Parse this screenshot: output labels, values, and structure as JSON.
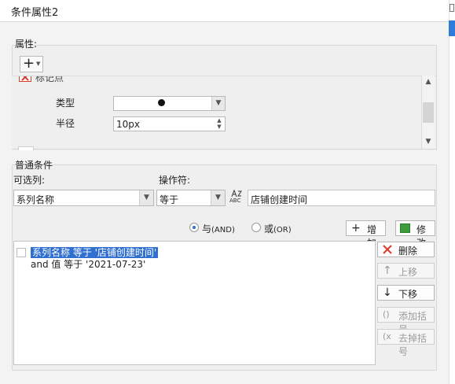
{
  "window": {
    "title": "条件属性2"
  },
  "attributes": {
    "section_title": "属性:",
    "add_button_symbol": "+",
    "marker_label": "标记点",
    "type_label": "类型",
    "type_value": "●",
    "radius_label": "半径",
    "radius_value": "10px"
  },
  "condition": {
    "section_title": "普通条件",
    "candidate_label": "可选列:",
    "operator_label": "操作符:",
    "field_value": "系列名称",
    "operator_value": "等于",
    "value_text": "店铺创建时间",
    "abc_icon": "ABC",
    "and_label": "与",
    "and_sub": "(AND)",
    "or_label": "或",
    "or_sub": "(OR)",
    "selected_logic": "and",
    "add_label": "增加",
    "edit_label": "修改",
    "delete_label": "删除",
    "up_label": "上移",
    "down_label": "下移",
    "add_bracket_label": "添加括号",
    "remove_bracket_label": "去掉括号",
    "rows": [
      "系列名称 等于 '店铺创建时间'",
      "and 值 等于 '2021-07-23'"
    ]
  },
  "colors": {
    "accent": "#2f6fd0",
    "delete_red": "#d93a2a",
    "edit_green": "#3a9c3a"
  },
  "icons": {
    "add": "plus-icon",
    "delete": "x-icon",
    "up": "arrow-up-icon",
    "down": "arrow-down-icon",
    "edit": "edit-icon",
    "add_bracket": "bracket-icon",
    "remove_bracket": "bracket-remove-icon"
  }
}
